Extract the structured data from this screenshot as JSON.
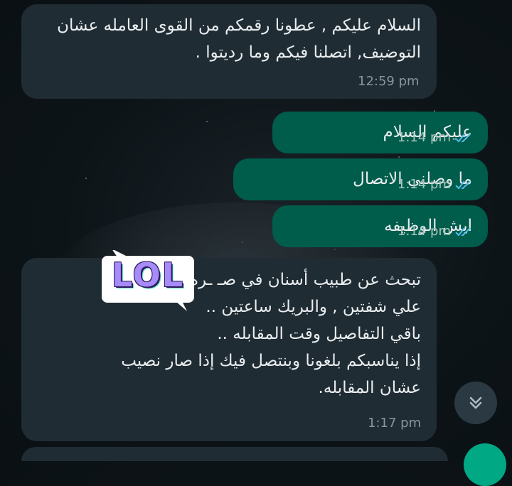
{
  "messages": [
    {
      "direction": "incoming",
      "lines": [
        "السلام عليكم , عطونا رقمكم من القوى العامله عشان",
        "التوضيف, اتصلنا فيكم وما رديتوا ."
      ],
      "time": "12:59 pm"
    },
    {
      "direction": "outgoing",
      "text": "عليكم السلام",
      "time": "1:14 pm",
      "status": "read"
    },
    {
      "direction": "outgoing",
      "text": "ما وصلني الاتصال",
      "time": "1:14 pm",
      "status": "read"
    },
    {
      "direction": "outgoing",
      "text": "ايش الوظيفه",
      "time": "1:14 pm",
      "status": "read"
    },
    {
      "direction": "incoming",
      "lines": [
        "تبحث عن طبيب أسنان في صـ        ـره ،العمل",
        "علي شفتين , والبريك ساعتين ..",
        "باقي التفاصيل وقت المقابله ..",
        "إذا يناسبكم بلغونا وبنتصل فيك إذا صار نصيب",
        "عشان المقابله."
      ],
      "time": "1:17 pm"
    }
  ],
  "sticker": {
    "text": "LOL"
  },
  "icons": {
    "read_ticks": "double-check-icon",
    "scroll_down": "double-chevron-down-icon"
  },
  "colors": {
    "incoming_bubble": "#202c33",
    "outgoing_bubble": "#005c4b",
    "read_ticks": "#53bdeb",
    "timestamp": "#8696a0"
  }
}
